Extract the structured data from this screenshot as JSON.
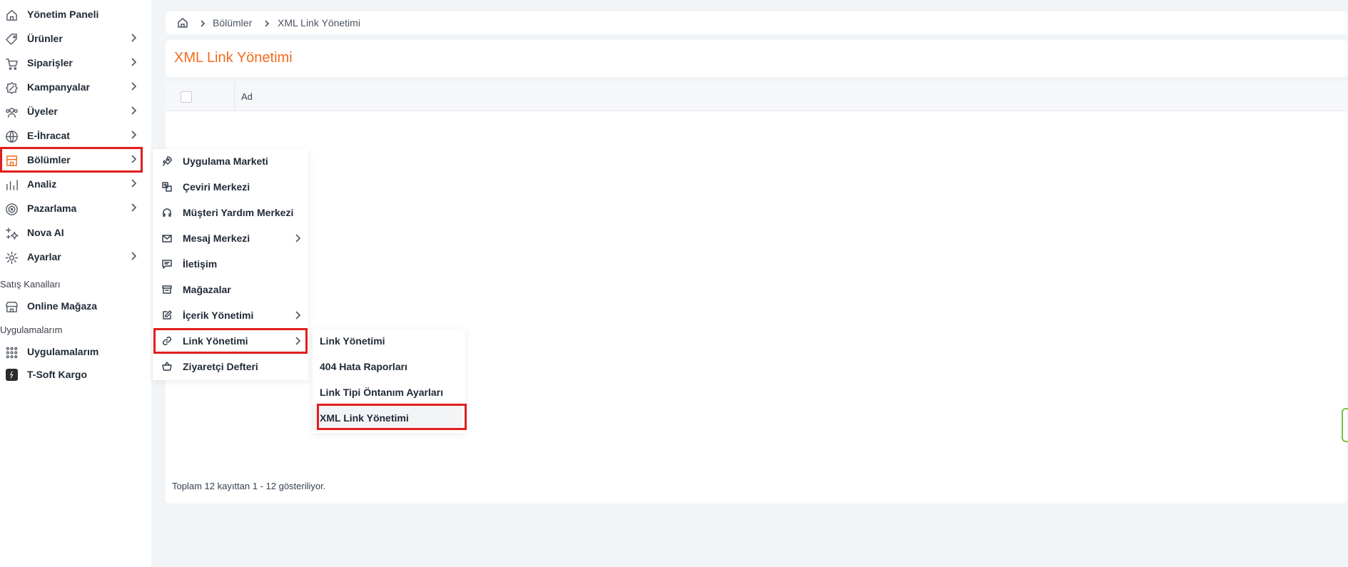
{
  "sidebar": {
    "items": [
      {
        "label": "Yönetim Paneli",
        "icon": "home-icon"
      },
      {
        "label": "Ürünler",
        "icon": "tag-icon"
      },
      {
        "label": "Siparişler",
        "icon": "cart-icon"
      },
      {
        "label": "Kampanyalar",
        "icon": "discount-icon"
      },
      {
        "label": "Üyeler",
        "icon": "users-icon"
      },
      {
        "label": "E-İhracat",
        "icon": "globe-icon"
      },
      {
        "label": "Bölümler",
        "icon": "store-sections-icon"
      },
      {
        "label": "Analiz",
        "icon": "chart-icon"
      },
      {
        "label": "Pazarlama",
        "icon": "target-icon"
      },
      {
        "label": "Nova AI",
        "icon": "sparkle-icon"
      },
      {
        "label": "Ayarlar",
        "icon": "gear-icon"
      }
    ],
    "sales_channels_title": "Satış Kanalları",
    "online_store": "Online Mağaza",
    "apps_title": "Uygulamalarım",
    "apps_item": "Uygulamalarım",
    "tsoft_kargo": "T-Soft Kargo"
  },
  "breadcrumb": {
    "items": [
      "Bölümler",
      "XML Link Yönetimi"
    ]
  },
  "page": {
    "title": "XML Link Yönetimi"
  },
  "table": {
    "columns": [
      "Ad"
    ],
    "footer": "Toplam 12 kayıttan 1 - 12 gösteriliyor."
  },
  "sections_menu": {
    "items": [
      {
        "label": "Uygulama Marketi",
        "icon": "rocket-icon"
      },
      {
        "label": "Çeviri Merkezi",
        "icon": "translate-icon"
      },
      {
        "label": "Müşteri Yardım Merkezi",
        "icon": "headset-icon"
      },
      {
        "label": "Mesaj Merkezi",
        "icon": "mail-icon"
      },
      {
        "label": "İletişim",
        "icon": "message-icon"
      },
      {
        "label": "Mağazalar",
        "icon": "store-icon"
      },
      {
        "label": "İçerik Yönetimi",
        "icon": "edit-icon"
      },
      {
        "label": "Link Yönetimi",
        "icon": "link-icon"
      },
      {
        "label": "Ziyaretçi Defteri",
        "icon": "basket-icon"
      }
    ]
  },
  "link_menu": {
    "items": [
      "Link Yönetimi",
      "404 Hata Raporları",
      "Link Tipi Öntanım Ayarları",
      "XML Link Yönetimi"
    ]
  },
  "colors": {
    "accent": "#f36b1c",
    "highlight": "#e01e1e"
  }
}
